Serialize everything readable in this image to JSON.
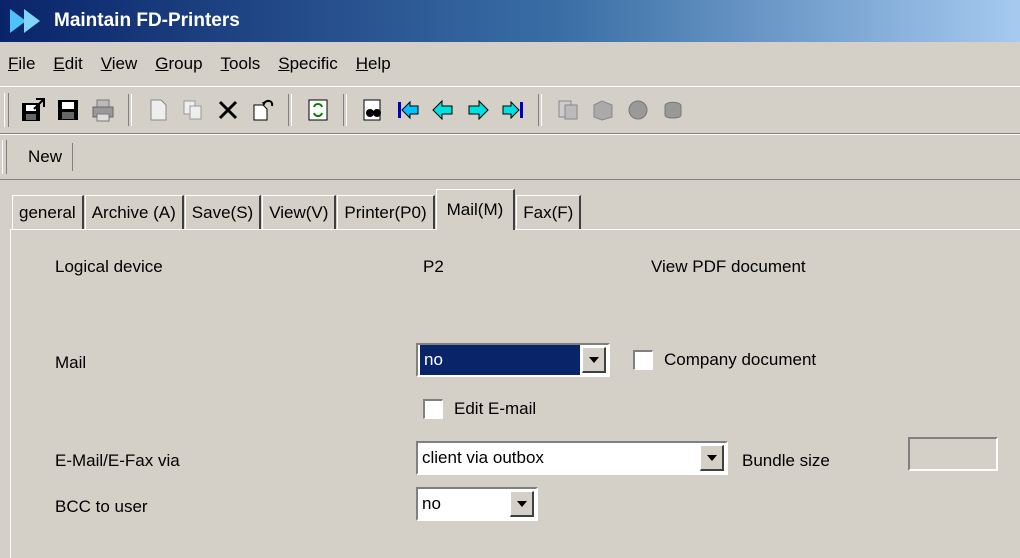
{
  "window": {
    "title": "Maintain FD-Printers"
  },
  "menu": [
    {
      "underline": "F",
      "rest": "ile"
    },
    {
      "underline": "E",
      "rest": "dit"
    },
    {
      "underline": "V",
      "rest": "iew"
    },
    {
      "underline": "G",
      "rest": "roup"
    },
    {
      "underline": "T",
      "rest": "ools"
    },
    {
      "underline": "S",
      "rest": "pecific"
    },
    {
      "underline": "H",
      "rest": "elp"
    }
  ],
  "toolbar": {
    "icons": [
      "exit-save-icon",
      "save-icon",
      "print-icon",
      "new-document-icon",
      "copy-icon",
      "delete-icon",
      "undo-icon",
      "refresh-icon",
      "find-icon",
      "first-record-icon",
      "previous-record-icon",
      "next-record-icon",
      "last-record-icon",
      "group-1-icon",
      "group-2-icon",
      "group-3-icon",
      "group-4-icon"
    ]
  },
  "subbar": {
    "new_label": "New"
  },
  "tabs": [
    "general",
    "Archive (A)",
    "Save(S)",
    "View(V)",
    "Printer(P0)",
    "Mail(M)",
    "Fax(F)"
  ],
  "active_tab": "Mail(M)",
  "form": {
    "logical_device_label": "Logical device",
    "logical_device_value": "P2",
    "view_pdf_text": "View PDF document",
    "mail_label": "Mail",
    "mail_value": "no",
    "company_document_label": "Company document",
    "edit_email_label": "Edit E-mail",
    "email_via_label": "E-Mail/E-Fax via",
    "email_via_value": "client via outbox",
    "bundle_size_label": "Bundle size",
    "bundle_size_value": "",
    "bcc_label": "BCC to user",
    "bcc_value": "no"
  }
}
